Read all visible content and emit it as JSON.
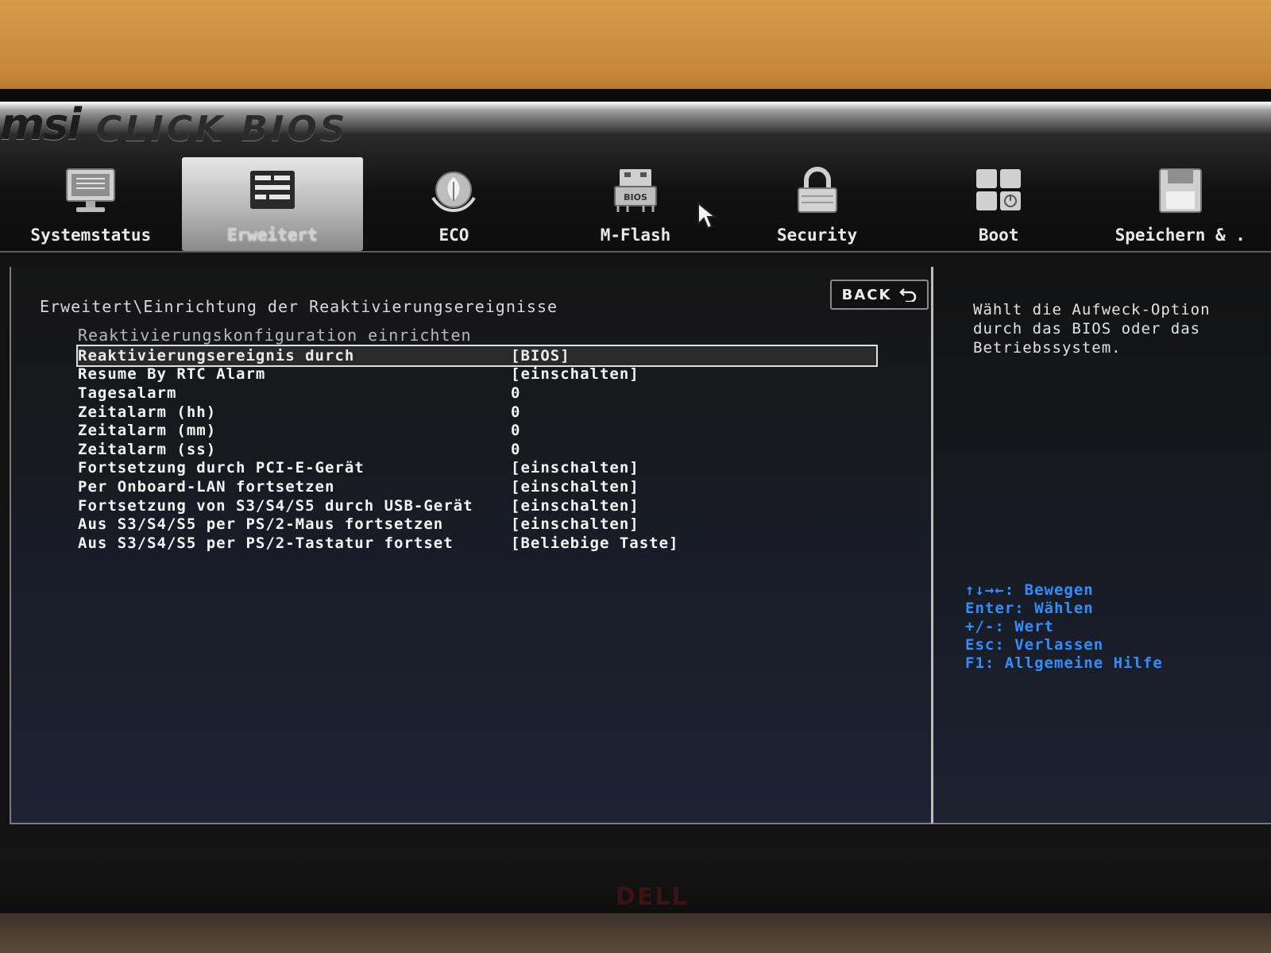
{
  "header": {
    "brand_logo": "msi",
    "brand_product": "CLICK BIOS"
  },
  "tabs": [
    {
      "label": "Systemstatus",
      "icon": "monitor-icon",
      "active": false
    },
    {
      "label": "Erweitert",
      "icon": "settings-panel-icon",
      "active": true
    },
    {
      "label": "ECO",
      "icon": "eco-leaf-icon",
      "active": false
    },
    {
      "label": "M-Flash",
      "icon": "bios-chip-icon",
      "active": false
    },
    {
      "label": "Security",
      "icon": "padlock-icon",
      "active": false
    },
    {
      "label": "Boot",
      "icon": "boot-grid-icon",
      "active": false
    },
    {
      "label": "Speichern & .",
      "icon": "floppy-disk-icon",
      "active": false
    }
  ],
  "back_button": {
    "label": "BACK"
  },
  "breadcrumb": "Erweitert\\Einrichtung der Reaktivierungsereignisse",
  "section_title": "Reaktivierungskonfiguration einrichten",
  "settings": [
    {
      "label": "Reaktivierungsereignis durch",
      "value": "[BIOS]",
      "selected": true
    },
    {
      "label": "Resume By RTC Alarm",
      "value": "[einschalten]"
    },
    {
      "label": "Tagesalarm",
      "value": "0"
    },
    {
      "label": "Zeitalarm (hh)",
      "value": "0"
    },
    {
      "label": "Zeitalarm (mm)",
      "value": "0"
    },
    {
      "label": "Zeitalarm (ss)",
      "value": "0"
    },
    {
      "label": "Fortsetzung durch PCI-E-Gerät",
      "value": "[einschalten]"
    },
    {
      "label": "Per Onboard-LAN fortsetzen",
      "value": "[einschalten]"
    },
    {
      "label": "Fortsetzung von S3/S4/S5 durch USB-Gerät",
      "value": "[einschalten]"
    },
    {
      "label": "Aus S3/S4/S5 per PS/2-Maus fortsetzen",
      "value": "[einschalten]"
    },
    {
      "label": "Aus S3/S4/S5 per PS/2-Tastatur fortset",
      "value": "[Beliebige Taste]"
    }
  ],
  "help_text": "Wählt die Aufweck-Option\ndurch das BIOS oder das\nBetriebssystem.",
  "key_hints": [
    "↑↓→←: Bewegen",
    "Enter: Wählen",
    "+/-: Wert",
    "Esc: Verlassen",
    "F1: Allgemeine Hilfe"
  ],
  "monitor_brand": "DELL",
  "colors": {
    "key_hint": "#2f8fff",
    "text": "#f4f4f4",
    "background": "#121212"
  }
}
